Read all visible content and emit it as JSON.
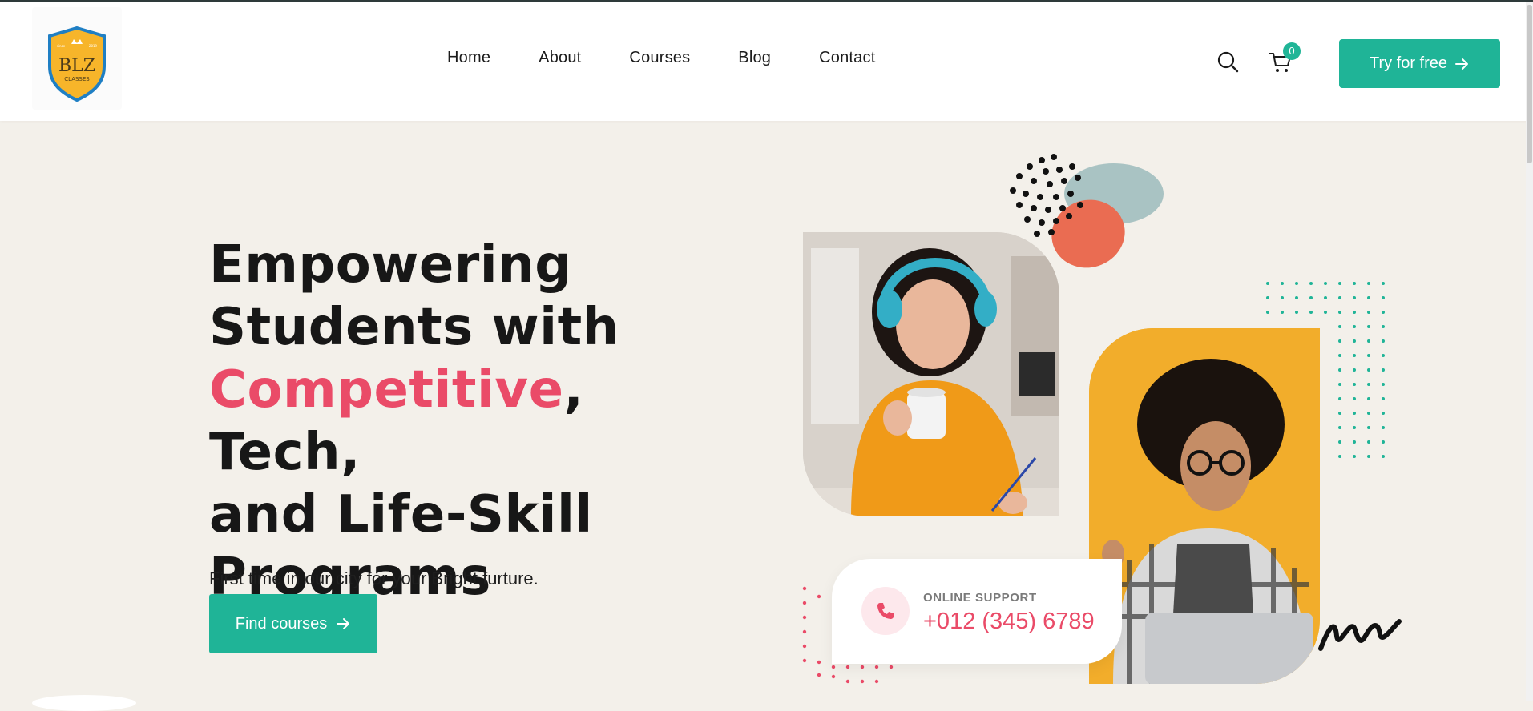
{
  "brand": {
    "name": "BLZ",
    "sub": "CLASSES",
    "small_left": "since",
    "small_right": "2019",
    "colors": {
      "shield": "#f7b52a",
      "shield_border": "#1f7fc4"
    }
  },
  "nav": {
    "items": [
      "Home",
      "About",
      "Courses",
      "Blog",
      "Contact"
    ]
  },
  "header_actions": {
    "search_icon": "search-icon",
    "cart_icon": "cart-icon",
    "cart_count": "0",
    "try_label": "Try for free"
  },
  "hero": {
    "title_line1": "Empowering",
    "title_line2": "Students with",
    "title_accent": "Competitive",
    "title_line3_rest": ", Tech,",
    "title_line4": "and Life-Skill",
    "title_line5": "Programs",
    "subtitle": "First time in our city for your Bright furture.",
    "cta_label": "Find courses"
  },
  "support": {
    "label": "ONLINE SUPPORT",
    "phone": "+012 (345) 6789",
    "icon": "phone-icon"
  },
  "colors": {
    "accent": "#1fb497",
    "pink": "#ea4b68",
    "background": "#f3f0ea",
    "orange": "#f2ad2b"
  }
}
